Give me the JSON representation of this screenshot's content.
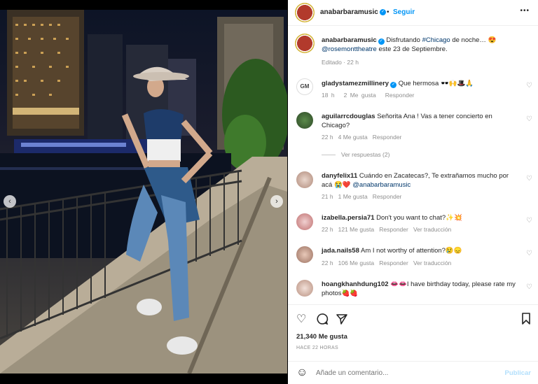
{
  "header": {
    "username": "anabarbaramusic",
    "follow_label": "Seguir",
    "more_label": "•••"
  },
  "caption": {
    "username": "anabarbaramusic",
    "text_pre": " Disfrutando ",
    "hashtag": "#Chicago",
    "text_mid": " de noche… 😍",
    "mention": "@rosemonttheatre",
    "text_post": " este 23 de Septiembre.",
    "edited": "Editado · 22 h"
  },
  "comments": [
    {
      "username": "gladystamezmillinery",
      "verified": true,
      "text": "Que hermosa 🕶️🙌🎩🙏",
      "time": "18 h",
      "likes": "2 Me gusta",
      "reply": "Responder",
      "translate": ""
    },
    {
      "username": "aguilarrcdouglas",
      "verified": false,
      "text": "Señorita Ana ! Vas a tener concierto en Chicago?",
      "time": "22 h",
      "likes": "4 Me gusta",
      "reply": "Responder",
      "translate": "",
      "view_replies": "Ver respuestas (2)"
    },
    {
      "username": "danyfelix11",
      "verified": false,
      "text": "Cuándo en Zacatecas?, Te extrañamos mucho por acá 😭❤️ ",
      "mention": "@anabarbaramusic",
      "time": "21 h",
      "likes": "1 Me gusta",
      "reply": "Responder",
      "translate": ""
    },
    {
      "username": "izabella.persia71",
      "verified": false,
      "text": "Don't you want to chat?✨💥",
      "time": "22 h",
      "likes": "121 Me gusta",
      "reply": "Responder",
      "translate": "Ver traducción"
    },
    {
      "username": "jada.nails58",
      "verified": false,
      "text": "Am I not worthy of attention?😢😞",
      "time": "22 h",
      "likes": "106 Me gusta",
      "reply": "Responder",
      "translate": "Ver traducción"
    },
    {
      "username": "hoangkhanhdung102",
      "verified": false,
      "text": "👄👄I have birthday today, please rate my photos🍓🍓",
      "time": "",
      "likes": "",
      "reply": "",
      "translate": ""
    }
  ],
  "actions": {
    "likes_count": "21,340 Me gusta",
    "posted": "HACE 22 HORAS"
  },
  "comment_box": {
    "placeholder": "Añade un comentario...",
    "publish_label": "Publicar"
  },
  "colors": {
    "accent": "#0095f6",
    "link": "#00376b",
    "text": "#262626",
    "muted": "#8e8e8e"
  }
}
